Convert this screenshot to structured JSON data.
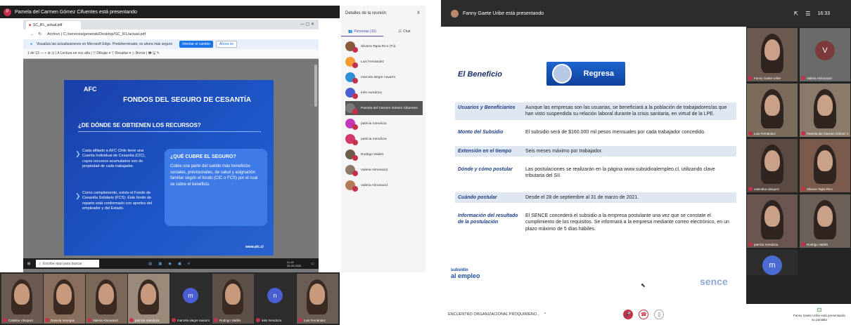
{
  "left": {
    "presenter_banner": "Pamela del Carmen Gómez Cifuentes está presentando",
    "presenter_initial": "P",
    "browser": {
      "tab_title": "SC_IFL_actual.pdf",
      "url": "Archivo | C:/services/generals/Desktop/SC_IFL/actual.pdf",
      "notice_text": "Visualiza las actualizaciones en Microsoft Edge. Predeterminado, es ahora más seguro",
      "notice_primary": "Intentar el cambio",
      "notice_secondary": "Ahora no",
      "pdf_toolbar": "1  de 13                                                     —  +   ⊕   ⊡   |  A Lectura en voz alta  |  ▽ Dibujar  ▾  ▽ Resaltar  ▾  ◇ Borrar   |  🖶  🖫  ✎"
    },
    "slide": {
      "logo": "AFC",
      "title": "FONDOS DEL SEGURO DE CESANTÍA",
      "question": "¿DE DÓNDE SE OBTIENEN LOS RECURSOS?",
      "bullet1": "Cada afiliado a AFC Chile tiene una Cuenta Individual de Cesantía (CIC), cuyos recursos acumulados son de propiedad de cada trabajador.",
      "bullet2": "Como complemento, existe el Fondo de Cesantía Solidario (FCS). Este fondo de reparto está conformado con aportes del empleador y del Estado.",
      "box_title": "¿QUÉ CUBRE EL SEGURO?",
      "box_text": "Cubre una parte del sueldo más beneficios sociales, previsionales, de salud y asignación familiar según el fondo (CIC o FCS) por el cual se cobre el beneficio.",
      "url": "www.afc.cl"
    },
    "taskbar": {
      "search_placeholder": "Escribe aquí para buscar",
      "clock": "11:15\n29-09-2020"
    },
    "panel": {
      "title": "Detalles de la reunión",
      "close": "X",
      "tab_people": "Personas (15)",
      "tab_chat": "Chat",
      "participants": [
        {
          "name": "Silvana Tapia Rico (Tú)",
          "color": "#8a5a3c"
        },
        {
          "name": "Luis Fernández",
          "color": "#f39c33"
        },
        {
          "name": "marcela alegre navarro",
          "color": "#2f8fd8"
        },
        {
          "name": "inés mendoza",
          "color": "#4a5fd1"
        },
        {
          "name": "Pamela del Carmen Gómez Cifuentes",
          "color": "#7a7a7a"
        },
        {
          "name": "patricia mendoza",
          "color": "#c238b7"
        },
        {
          "name": "patricia mendoza",
          "color": "#d6376a"
        },
        {
          "name": "Rodrigo Valdés",
          "color": "#6c5a4a"
        },
        {
          "name": "Valeria Almonacid",
          "color": "#8f7a6a"
        },
        {
          "name": "Valeria Almonacid",
          "color": "#b57a5a"
        }
      ]
    },
    "strip": [
      {
        "name": "Catalina Vásquez",
        "type": "video"
      },
      {
        "name": "Daniela Venegas",
        "type": "video"
      },
      {
        "name": "Valeria Almonacid",
        "type": "video"
      },
      {
        "name": "patricia mendoza",
        "type": "video"
      },
      {
        "name": "marcela alegre navarro",
        "type": "avatar",
        "initial": "m"
      },
      {
        "name": "Rodrigo Valdés",
        "type": "video"
      },
      {
        "name": "inés mendoza",
        "type": "avatar",
        "initial": "n"
      },
      {
        "name": "Luis Fernández",
        "type": "video"
      }
    ]
  },
  "right": {
    "presenter_banner": "Fanny Gaete Uribe está presentando",
    "clock": "16:33",
    "slide": {
      "heading": "El Beneficio",
      "logo_text": "Regresa",
      "rows": [
        {
          "k": "Usuarios y Beneficiarios",
          "v": "Aunque las empresas son las usuarias, se beneficiará a la población de trabajadores/as que han visto suspendida su relación laboral durante la crisis sanitaria, en virtud de la LPE.",
          "shade": true
        },
        {
          "k": "Monto del Subsidio",
          "v": "El subsidio será de $160.000 mil pesos mensuales por cada trabajador concedido.",
          "shade": false
        },
        {
          "k": "Extensión en el tiempo",
          "v": "Seis meses máximo por trabajador.",
          "shade": true
        },
        {
          "k": "Dónde y cómo postular",
          "v": "Las postulaciones se realizarán en la página www.subsidioalempleo.cl, utilizando clave tributaria del SII.",
          "shade": false
        },
        {
          "k": "Cuándo postular",
          "v": "Desde el 28 de septiembre al 31 de marzo de 2021.",
          "shade": true
        },
        {
          "k": "Información del resultado de la postulación",
          "v": "El SENCE concederá el subsidio a la empresa postulante una vez que se constate el cumplimiento de los requisitos. Se informará a la empresa mediante correo electrónico, en un plazo máximo de 5 días hábiles.",
          "shade": false
        }
      ],
      "footer_left_1": "subsidio",
      "footer_left_2": "al empleo",
      "footer_right": "sence"
    },
    "side_tiles": [
      {
        "name": "Fanny Gaete Uribe",
        "type": "video"
      },
      {
        "name": "Valeria Almonacid",
        "type": "avatar",
        "initial": "V"
      },
      {
        "name": "Luis Fernández",
        "type": "video"
      },
      {
        "name": "Pamela del Carmen Gómez C",
        "type": "video"
      },
      {
        "name": "valentina vásquez",
        "type": "video"
      },
      {
        "name": "Silvana Tapia Rico",
        "type": "video"
      },
      {
        "name": "patricia mendoza",
        "type": "video"
      },
      {
        "name": "Rodrigo Valdés",
        "type": "video"
      },
      {
        "name": "",
        "type": "avatar",
        "initial": "m"
      }
    ],
    "bottom": {
      "meeting_name": "ENCUENTRO ORGANIZACIONAL PROQUIRIENO...",
      "share_label": "Fanny Gaete Uribe está presentando su pantalla"
    }
  }
}
